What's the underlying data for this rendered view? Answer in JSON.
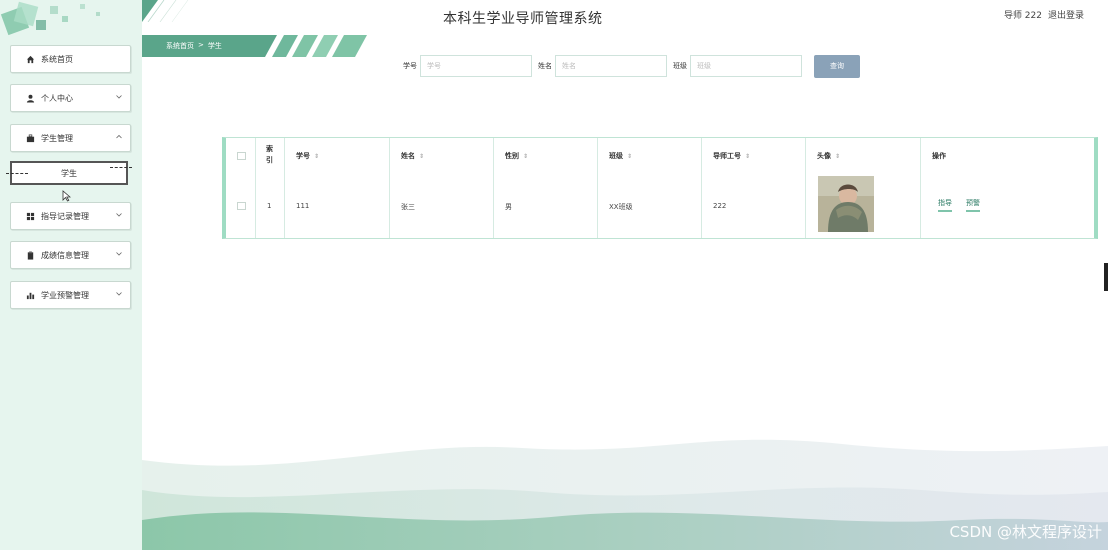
{
  "header": {
    "title": "本科生学业导师管理系统",
    "user_label": "导师 222",
    "logout_label": "退出登录"
  },
  "breadcrumb": {
    "home": "系统首页",
    "separator": ">",
    "current": "学生"
  },
  "sidebar": {
    "items": [
      {
        "label": "系统首页",
        "icon": "home-icon"
      },
      {
        "label": "个人中心",
        "icon": "person-icon"
      },
      {
        "label": "学生管理",
        "icon": "briefcase-icon"
      },
      {
        "label": "学生",
        "icon": ""
      },
      {
        "label": "指导记录管理",
        "icon": "grid-icon"
      },
      {
        "label": "成绩信息管理",
        "icon": "clipboard-icon"
      },
      {
        "label": "学业预警管理",
        "icon": "bar-chart-icon"
      }
    ]
  },
  "search": {
    "student_id_label": "学号",
    "student_id_placeholder": "学号",
    "name_label": "姓名",
    "name_placeholder": "姓名",
    "class_label": "班级",
    "class_placeholder": "班级",
    "button_label": "查询"
  },
  "table": {
    "headers": {
      "index": "索引",
      "student_id": "学号",
      "name": "姓名",
      "gender": "性别",
      "class": "班级",
      "teacher_id": "导师工号",
      "avatar": "头像",
      "actions": "操作"
    },
    "rows": [
      {
        "index": "1",
        "student_id": "111",
        "name": "张三",
        "gender": "男",
        "class": "XX班级",
        "teacher_id": "222",
        "action_guide": "指导",
        "action_warn": "预警"
      }
    ]
  },
  "watermark": "CSDN @林文程序设计",
  "colors": {
    "sidebar_bg": "#e6f5ee",
    "accent_green": "#5aa58a",
    "search_button": "#8aa2b8",
    "table_border": "#9fdcc3"
  }
}
